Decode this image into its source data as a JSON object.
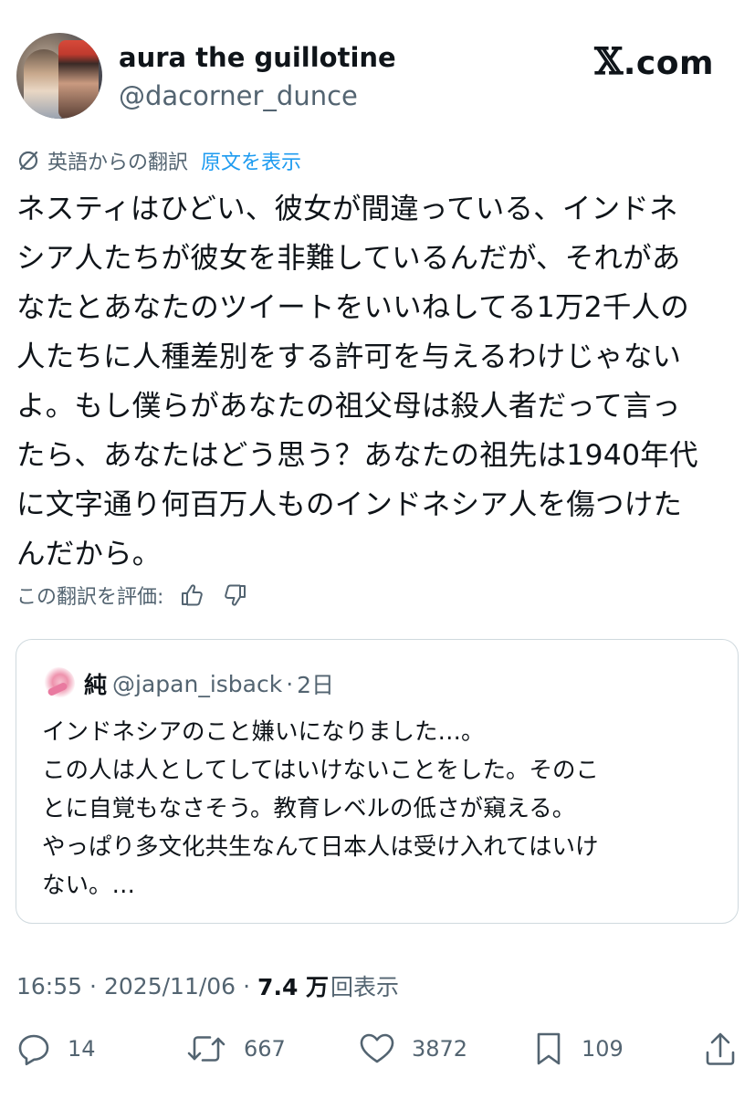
{
  "author": {
    "display_name": "aura the guillotine",
    "handle": "@dacorner_dunce"
  },
  "brand": {
    "mark": "𝕏",
    "domain": ".com"
  },
  "translation": {
    "label": "英語からの翻訳",
    "show_original": "原文を表示",
    "icon": "translate-icon"
  },
  "tweet": {
    "text": "ネスティはひどい、彼女が間違っている、インドネ\nシア人たちが彼女を非難しているんだが、それがあ\nなたとあなたのツイートをいいねしてる1万2千人の\n人たちに人種差別をする許可を与えるわけじゃない\nよ。もし僕らがあなたの祖父母は殺人者だって言っ\nたら、あなたはどう思う？あなたの祖先は1940年代\nに文字通り何百万人ものインドネシア人を傷つけた\nんだから。"
  },
  "rate": {
    "label": "この翻訳を評価:"
  },
  "quote": {
    "name": "純",
    "handle": "@japan_isback",
    "separator": "·",
    "time": "2日",
    "text": "インドネシアのこと嫌いになりました…。\nこの人は人としてしてはいけないことをした。そのこ\nとに自覚もなさそう。教育レベルの低さが窺える。\nやっぱり多文化共生なんて日本人は受け入れてはいけ\nない。…"
  },
  "meta": {
    "time": "16:55",
    "dot1": "·",
    "date": "2025/11/06",
    "dot2": "·",
    "views": "7.4 万",
    "views_label": "回表示"
  },
  "actions": {
    "reply_count": "14",
    "repost_count": "667",
    "like_count": "3872",
    "bookmark_count": "109"
  },
  "colors": {
    "text": "#0f1419",
    "secondary": "#536471",
    "link": "#1d9bf0",
    "border": "#cfd9de"
  }
}
